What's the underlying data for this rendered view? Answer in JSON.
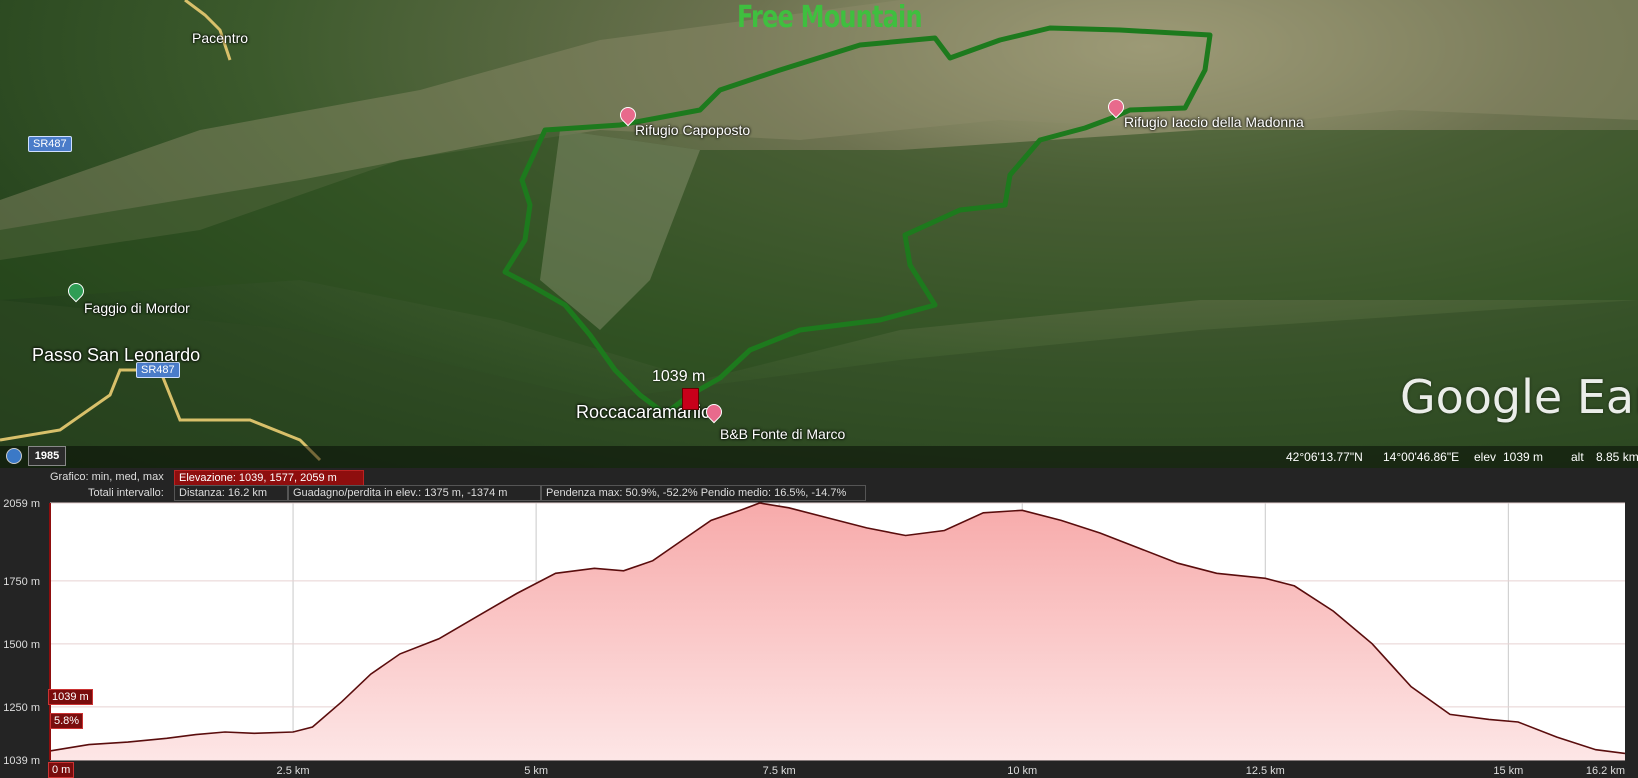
{
  "map": {
    "watermark": "Free Mountain",
    "logo_text": "Google Earth",
    "year": "1985",
    "places": {
      "pacentro": "Pacentro",
      "rifugio_capoposto": "Rifugio Capoposto",
      "rifugio_iaccio": "Rifugio Iaccio della Madonna",
      "faggio": "Faggio di Mordor",
      "passo": "Passo San Leonardo",
      "roccacaramanico": "Roccacaramanico",
      "bnb": "B&B Fonte di Marco"
    },
    "road_label": "SR487",
    "cursor_elevation": "1039 m",
    "status": {
      "lat": "42°06'13.77\"N",
      "lon": "14°00'46.86\"E",
      "elev_label": "elev",
      "elev": "1039 m",
      "alt_label": "alt",
      "alt": "8.85 km"
    }
  },
  "profile": {
    "graph_label": "Grafico: min, med, max",
    "elevation_box": "Elevazione: 1039, 1577, 2059 m",
    "totals_label": "Totali intervallo:",
    "distance_box": "Distanza: 16.2 km",
    "gain_box": "Guadagno/perdita in elev.: 1375 m, -1374 m",
    "slope_box": "Pendenza max: 50.9%, -52.2% Pendio medio: 16.5%, -14.7%",
    "cursor_elev_tag": "1039 m",
    "cursor_slope_tag": "5.8%",
    "cursor_dist_tag": "0 m",
    "colors": {
      "fill": "#f7aaaa",
      "line": "#5a0d0d",
      "accent": "#8e0e0e"
    }
  },
  "chart_data": {
    "type": "area",
    "title": "",
    "xlabel": "",
    "ylabel": "",
    "x_tick_labels": [
      "0 m",
      "2.5 km",
      "5 km",
      "7.5 km",
      "10 km",
      "12.5 km",
      "15 km",
      "16.2 km"
    ],
    "y_tick_labels": [
      "2059 m",
      "1750 m",
      "1500 m",
      "1250 m",
      "1039 m"
    ],
    "xlim": [
      0,
      16.2
    ],
    "ylim": [
      1039,
      2059
    ],
    "grid": true,
    "series": [
      {
        "x": [
          0,
          0.4,
          0.8,
          1.2,
          1.5,
          1.8,
          2.1,
          2.5,
          2.7,
          3.0,
          3.3,
          3.6,
          4.0,
          4.4,
          4.8,
          5.2,
          5.6,
          5.9,
          6.2,
          6.5,
          6.8,
          7.1,
          7.3,
          7.6,
          8.0,
          8.4,
          8.8,
          9.2,
          9.6,
          10.0,
          10.4,
          10.8,
          11.2,
          11.6,
          12.0,
          12.5,
          12.8,
          13.2,
          13.6,
          14.0,
          14.4,
          14.8,
          15.1,
          15.5,
          15.9,
          16.2
        ],
        "y": [
          1075,
          1100,
          1110,
          1125,
          1140,
          1150,
          1145,
          1150,
          1170,
          1270,
          1380,
          1460,
          1520,
          1610,
          1700,
          1780,
          1800,
          1790,
          1830,
          1910,
          1990,
          2030,
          2059,
          2040,
          2000,
          1960,
          1930,
          1950,
          2020,
          2030,
          1990,
          1940,
          1880,
          1820,
          1780,
          1760,
          1730,
          1630,
          1500,
          1330,
          1220,
          1200,
          1190,
          1130,
          1080,
          1065
        ]
      }
    ]
  }
}
